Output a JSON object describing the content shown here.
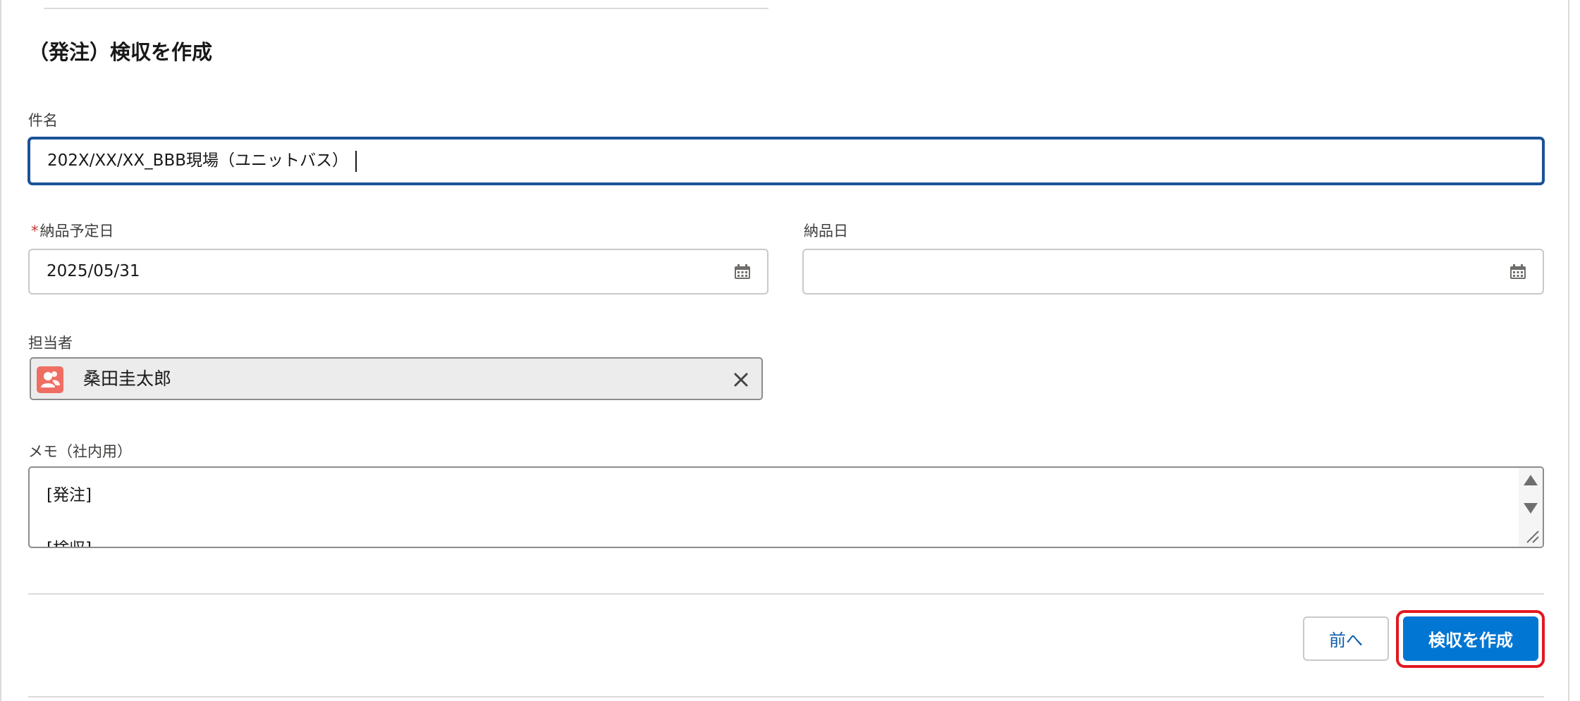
{
  "form": {
    "title": "（発注）検収を作成",
    "subject": {
      "label": "件名",
      "value": "202X/XX/XX_BBB現場（ユニットバス）"
    },
    "planned_delivery": {
      "required_mark": "*",
      "label": "納品予定日",
      "value": "2025/05/31",
      "icon": "calendar-icon"
    },
    "delivery_date": {
      "label": "納品日",
      "value": "",
      "icon": "calendar-icon"
    },
    "owner": {
      "label": "担当者",
      "value": "桑田圭太郎",
      "icon": "user-avatar-icon",
      "clear_icon": "close-icon"
    },
    "memo": {
      "label": "メモ（社内用）",
      "lines": [
        "[発注]",
        "",
        "[検収]"
      ]
    }
  },
  "buttons": {
    "back": "前へ",
    "create": "検収を作成"
  },
  "colors": {
    "primary": "#0176d3",
    "focus_border": "#1b5297",
    "highlight": "#e2181f",
    "required": "#c23934",
    "avatar": "#ef6e64"
  }
}
